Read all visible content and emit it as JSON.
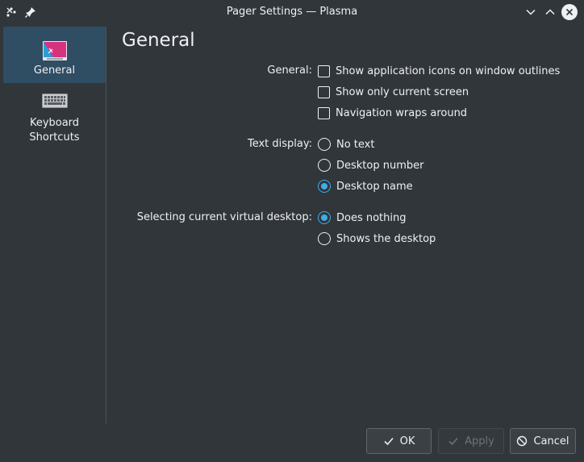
{
  "window": {
    "title": "Pager Settings — Plasma",
    "left_icons": [
      "app-menu-icon",
      "pin-icon"
    ],
    "right_icons": [
      "minimize-icon",
      "maximize-icon",
      "close-icon"
    ]
  },
  "sidebar": {
    "items": [
      {
        "label": "General",
        "icon": "general-settings-icon",
        "active": true
      },
      {
        "label": "Keyboard Shortcuts",
        "label_line1": "Keyboard",
        "label_line2": "Shortcuts",
        "icon": "keyboard-icon",
        "active": false
      }
    ]
  },
  "main": {
    "title": "General",
    "general": {
      "label": "General:",
      "options": [
        {
          "label": "Show application icons on window outlines",
          "checked": false
        },
        {
          "label": "Show only current screen",
          "checked": false
        },
        {
          "label": "Navigation wraps around",
          "checked": false
        }
      ]
    },
    "text_display": {
      "label": "Text display:",
      "options": [
        {
          "label": "No text",
          "selected": false
        },
        {
          "label": "Desktop number",
          "selected": false
        },
        {
          "label": "Desktop name",
          "selected": true
        }
      ]
    },
    "selecting": {
      "label": "Selecting current virtual desktop:",
      "options": [
        {
          "label": "Does nothing",
          "selected": true
        },
        {
          "label": "Shows the desktop",
          "selected": false
        }
      ]
    }
  },
  "buttons": {
    "ok": "OK",
    "apply": "Apply",
    "cancel": "Cancel"
  },
  "colors": {
    "background": "#31363b",
    "accent": "#3daee9",
    "sidebar_selected": "#2f4d63",
    "text": "#eff0f1"
  }
}
